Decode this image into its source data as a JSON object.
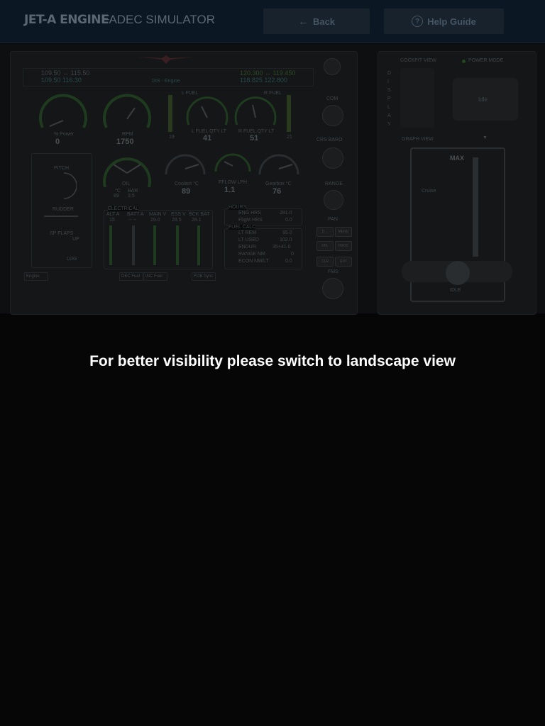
{
  "header": {
    "logo": "JET-A ENGINE",
    "subtitle": "FADEC SIMULATOR",
    "back_label": "Back",
    "help_label": "Help Guide"
  },
  "simulator": {
    "nav_left": [
      "109.50 ↔ 115.50",
      "109.50   116.30"
    ],
    "com_right": [
      "120.300 ↔ 119.450",
      "118.825   122.800"
    ],
    "status_line": "DIS - Engine",
    "gauge_power": {
      "label": "% Power",
      "value": "0"
    },
    "gauge_rpm": {
      "label": "RPM",
      "value": "1750"
    },
    "fuel_left_label": "L FUEL",
    "fuel_right_label": "R FUEL",
    "fuel_left_qty_label": "L FUEL QTY LT",
    "fuel_left_qty": "41",
    "fuel_right_qty_label": "R FUEL QTY LT",
    "fuel_right_qty": "51",
    "bar_left_val": "19",
    "bar_right_val": "21",
    "pitch_label": "PITCH",
    "rudder_label": "RUDDER",
    "flaps_label": "SP FLAPS",
    "flaps_up": "UP",
    "flaps_ldg": "LDG",
    "oil_label": "OIL",
    "oil_c": "°C",
    "oil_c_val": "89",
    "oil_bar": "BAR",
    "oil_bar_val": "3.5",
    "coolant_label": "Coolant °C",
    "coolant_value": "89",
    "fflow_label": "FFLOW LPH",
    "fflow_value": "1.1",
    "gearbox_label": "Gearbox °C",
    "gearbox_value": "76",
    "electrical": {
      "title": "ELECTRICAL",
      "headers": [
        "ALT A",
        "BATT A",
        "MAIN V",
        "ESS V",
        "BCK BAT"
      ],
      "values": [
        "15",
        "-- --",
        "29.0",
        "28.5",
        "28.1"
      ]
    },
    "hours": {
      "title": "HOURS",
      "rows": [
        [
          "ENG HRS",
          "281.0"
        ],
        [
          "Flight HRS",
          "0.0"
        ]
      ]
    },
    "fuel_calc": {
      "title": "FUEL CALC",
      "rows": [
        [
          "LT REM",
          "95.0"
        ],
        [
          "LT USED",
          "102.0"
        ],
        [
          "ENDUR",
          "35+41.0"
        ],
        [
          "RANGE NM",
          "0"
        ],
        [
          "ECON NM/LT",
          "0.0"
        ]
      ]
    },
    "softkeys": [
      "Engine",
      "DEC Fuel",
      "INC Fuel",
      "FOB Sync"
    ],
    "side_labels": {
      "com": "COM",
      "crs_baro": "CRS  BARO",
      "range": "RANGE",
      "pan": "PAN",
      "fms": "FMS",
      "menu": "MENU",
      "fpl": "FPL",
      "proc": "PROC",
      "clr": "CLR",
      "ent": "ENT"
    },
    "right_panel": {
      "cockpit_view": "COCKPIT VIEW",
      "power_mode": "POWER MODE",
      "idle": "Idle",
      "display_letters": [
        "D",
        "I",
        "S",
        "P",
        "L",
        "A",
        "Y"
      ],
      "graph_view": "GRAPH VIEW",
      "max": "MAX",
      "cruise": "Cruise",
      "idle_bottom": "IDLE"
    }
  },
  "overlay_message": "For better visibility please switch to landscape view",
  "colors": {
    "background": "#060606",
    "header": "#0b1722",
    "message": "#ffffff"
  }
}
